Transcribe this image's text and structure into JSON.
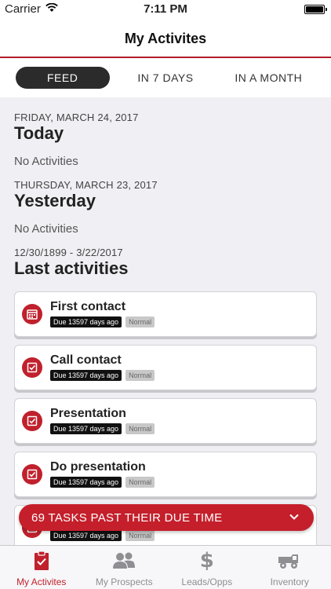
{
  "status": {
    "carrier": "Carrier",
    "time": "7:11 PM"
  },
  "nav": {
    "title": "My Activites"
  },
  "segments": [
    {
      "label": "FEED",
      "active": true
    },
    {
      "label": "IN 7 DAYS",
      "active": false
    },
    {
      "label": "IN A MONTH",
      "active": false
    }
  ],
  "sections": {
    "today": {
      "date": "FRIDAY, MARCH 24, 2017",
      "title": "Today",
      "empty": "No Activities"
    },
    "yesterday": {
      "date": "THURSDAY, MARCH 23, 2017",
      "title": "Yesterday",
      "empty": "No Activities"
    },
    "last": {
      "date": "12/30/1899 - 3/22/2017",
      "title": "Last activities"
    }
  },
  "activities": [
    {
      "title": "First contact",
      "due": "Due 13597 days ago",
      "priority": "Normal",
      "icon": "calendar-icon"
    },
    {
      "title": "Call contact",
      "due": "Due 13597 days ago",
      "priority": "Normal",
      "icon": "checkbox-icon"
    },
    {
      "title": "Presentation",
      "due": "Due 13597 days ago",
      "priority": "Normal",
      "icon": "checkbox-icon"
    },
    {
      "title": "Do presentation",
      "due": "Due 13597 days ago",
      "priority": "Normal",
      "icon": "checkbox-icon"
    },
    {
      "title": "",
      "due": "Due 13597 days ago",
      "priority": "Normal",
      "icon": "checkbox-icon"
    }
  ],
  "toast": {
    "text": "69 TASKS PAST THEIR DUE TIME"
  },
  "tabs": [
    {
      "label": "My Activites",
      "icon": "clipboard-check-icon",
      "active": true
    },
    {
      "label": "My Prospects",
      "icon": "people-icon",
      "active": false
    },
    {
      "label": "Leads/Opps",
      "icon": "dollar-icon",
      "active": false
    },
    {
      "label": "Inventory",
      "icon": "truck-icon",
      "active": false
    }
  ],
  "colors": {
    "accent": "#c0212c",
    "dark": "#2b2b2b"
  }
}
